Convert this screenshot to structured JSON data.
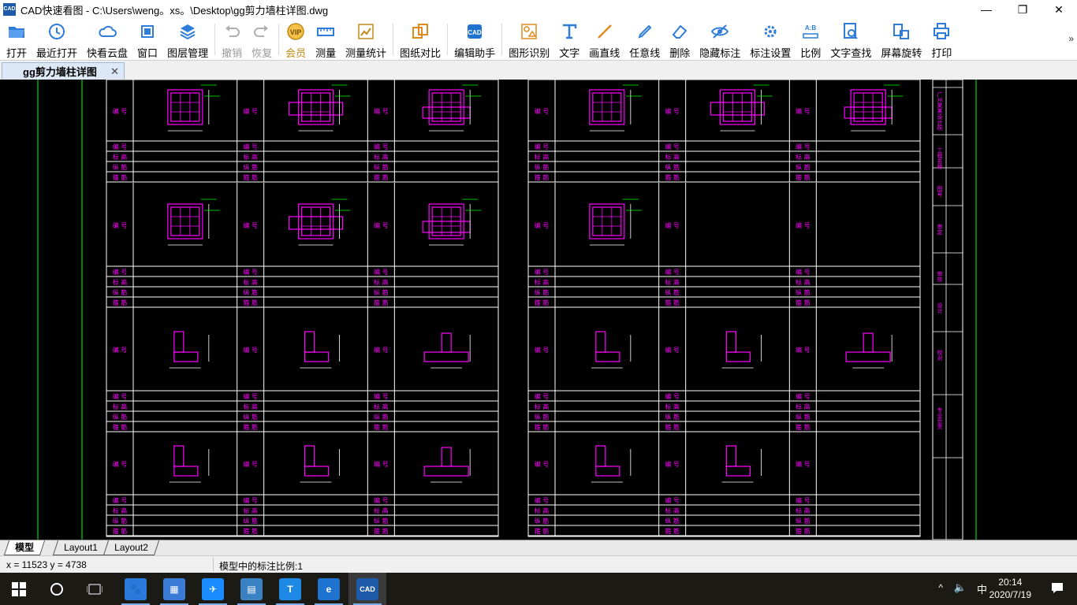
{
  "window": {
    "title": "CAD快速看图 - C:\\Users\\weng。xs。\\Desktop\\gg剪力墙柱详图.dwg",
    "logo_text": "CAD",
    "minimize": "—",
    "restore": "❐",
    "close": "✕"
  },
  "toolbar": {
    "items": [
      {
        "label": "打开",
        "icon": "folder-open-icon",
        "state": "normal"
      },
      {
        "label": "最近打开",
        "icon": "recent-clock-icon",
        "state": "normal"
      },
      {
        "label": "快看云盘",
        "icon": "cloud-icon",
        "state": "normal"
      },
      {
        "label": "窗口",
        "icon": "window-frame-icon",
        "state": "normal"
      },
      {
        "label": "图层管理",
        "icon": "layers-icon",
        "state": "normal"
      },
      {
        "label": "撤销",
        "icon": "undo-icon",
        "state": "disabled"
      },
      {
        "label": "恢复",
        "icon": "redo-icon",
        "state": "disabled"
      },
      {
        "label": "会员",
        "icon": "vip-icon",
        "state": "vip"
      },
      {
        "label": "测量",
        "icon": "ruler-icon",
        "state": "normal"
      },
      {
        "label": "测量统计",
        "icon": "measure-stats-icon",
        "state": "normal"
      },
      {
        "label": "图纸对比",
        "icon": "compare-icon",
        "state": "normal"
      },
      {
        "label": "编辑助手",
        "icon": "edit-assistant-icon",
        "state": "normal"
      },
      {
        "label": "图形识别",
        "icon": "shape-recognize-icon",
        "state": "normal"
      },
      {
        "label": "文字",
        "icon": "text-icon",
        "state": "normal"
      },
      {
        "label": "画直线",
        "icon": "line-icon",
        "state": "normal"
      },
      {
        "label": "任意线",
        "icon": "freehand-pen-icon",
        "state": "normal"
      },
      {
        "label": "删除",
        "icon": "eraser-icon",
        "state": "normal"
      },
      {
        "label": "隐藏标注",
        "icon": "hide-eye-icon",
        "state": "normal"
      },
      {
        "label": "标注设置",
        "icon": "annotation-settings-icon",
        "state": "normal"
      },
      {
        "label": "比例",
        "icon": "scale-icon",
        "state": "normal"
      },
      {
        "label": "文字查找",
        "icon": "text-search-icon",
        "state": "normal"
      },
      {
        "label": "屏幕旋转",
        "icon": "screen-rotate-icon",
        "state": "normal"
      },
      {
        "label": "打印",
        "icon": "printer-icon",
        "state": "normal"
      }
    ],
    "more": "»"
  },
  "doc_tab": {
    "label": "gg剪力墙柱详图",
    "close": "✕"
  },
  "drawing": {
    "header_cells": [
      "编 号",
      "标 高",
      "纵 筋",
      "箍 筋"
    ],
    "left_sheet": {
      "rows": [
        {
          "labels": [
            "GDZ1(GDZ1a)",
            "GDZ2",
            "GDZ3(GDZ3a)"
          ],
          "elev": [
            "-4.400~-0.100",
            "-4.400~-0.100",
            "-4.400~-0.100"
          ],
          "bars": [
            "12Φ20+10Φ16(5Φ16)",
            "12Φ20+10Φ16",
            "12Φ20+5Φ16"
          ],
          "stirrup": [
            "Φ10@100",
            "Φ10@100",
            "Φ10@100"
          ]
        },
        {
          "labels": [
            "GDZ4",
            "GDZ5",
            "GDZ6"
          ],
          "elev": [
            "-4.400~-0.100",
            "-4.400~-0.100",
            "-4.400~-0.100"
          ],
          "bars": [
            "12Φ20+5Φ16",
            "8Φ20+10Φ16",
            "8Φ20+12Φ16"
          ],
          "stirrup": [
            "Φ10@100",
            "Φ10@100",
            "Φ10@100"
          ]
        },
        {
          "labels": [
            "GJZ1",
            "GJZ2",
            "GYZ1"
          ],
          "elev": [
            "-4.400~-0.100",
            "-4.400~-0.100",
            "-4.400~-0.100"
          ],
          "bars": [
            "12Φ16",
            "12Φ16",
            "13Φ16"
          ],
          "stirrup": [
            "Φ10@100",
            "Φ10@100",
            "Φ10@100"
          ]
        },
        {
          "labels": [
            "GYZ2",
            "GYZ3",
            "GAZ1"
          ],
          "elev": [
            "-4.400~-0.100",
            "-4.400~-0.100",
            "-4.400~-0.100"
          ],
          "bars": [
            "18Φ16",
            "16Φ16",
            "8Φ16"
          ],
          "stirrup": [
            "Φ10@100",
            "Φ10@100",
            "Φ10@100"
          ]
        }
      ]
    },
    "right_sheet": {
      "rows": [
        {
          "labels": [
            "GDZ1",
            "GDZ2",
            "GDZ3"
          ],
          "elev": [
            "-0.100~7.700   7.700~15.500",
            "-0.100~7.700   7.700~15.500",
            "-0.100~7.700   7.700~15.500"
          ],
          "bars": [
            "12Φ20+5Φ16   12Φ20+5Φ16",
            "12Φ20+8Φ16   12Φ20+8Φ16",
            "12Φ20+5Φ16   12Φ20+5Φ16"
          ],
          "stirrup": [
            "Φ10@100   Φ8@150",
            "Φ10@100   Φ8@150",
            "Φ10@100   Φ8@150"
          ]
        },
        {
          "labels": [
            "GDZ4",
            "",
            ""
          ],
          "elev": [
            "-0.100~7.700   7.700~19.500",
            "",
            ""
          ],
          "bars": [
            "12Φ20+5Φ16   12Φ20+5Φ16",
            "",
            ""
          ],
          "stirrup": [
            "Φ10@100   Φ8@150",
            "",
            ""
          ]
        },
        {
          "labels": [
            "YJZ1   GJZ1",
            "YJZ2   GJZ2",
            "YYZ1   GYZ1"
          ],
          "elev": [
            "-0.100~7.700   7.700~17.400",
            "-0.100~7.700   7.700~17.400",
            "-0.100~7.700   7.700~17.400"
          ],
          "bars": [
            "12Φ16   12Φ14",
            "12Φ16   12Φ14",
            "18Φ16   18Φ14"
          ],
          "stirrup": [
            "Φ10@100   Φ8@150",
            "Φ10@100   Φ8@150",
            "Φ10@100   Φ8@150"
          ]
        },
        {
          "labels": [
            "YYZ2   GYZ2",
            "YYZ3   GYZ3",
            ""
          ],
          "elev": [
            "-0.100~7.700   7.700~17.400",
            "-0.100~7.700   7.700~17.400",
            ""
          ],
          "bars": [
            "18Φ16   18Φ14",
            "16Φ16   16Φ14",
            ""
          ],
          "stirrup": [
            "Φ10@100   Φ8@150",
            "Φ10@100   Φ8@150",
            ""
          ]
        }
      ]
    },
    "title_block": [
      "广州某某设计院",
      "工程名称",
      "图号",
      "审定",
      "审核",
      "设计",
      "校对",
      "专业负责"
    ]
  },
  "layout_tabs": [
    "模型",
    "Layout1",
    "Layout2"
  ],
  "status": {
    "coords": "x = 11523  y = 4738",
    "scale": "模型中的标注比例:1"
  },
  "taskbar": {
    "apps": [
      {
        "name": "baidu-netdisk-app",
        "glyph": "🐾",
        "color": "#2b7ad9"
      },
      {
        "name": "computer-manager-app",
        "glyph": "▦",
        "color": "#3a7bd5"
      },
      {
        "name": "dingtalk-app",
        "glyph": "✈",
        "color": "#1a8cff"
      },
      {
        "name": "office-assistant-app",
        "glyph": "▤",
        "color": "#3b82c4"
      },
      {
        "name": "text-editor-app",
        "glyph": "T",
        "color": "#1e88e5"
      },
      {
        "name": "edge-browser-app",
        "glyph": "e",
        "color": "#1e73d0"
      },
      {
        "name": "cad-viewer-app",
        "glyph": "CAD",
        "color": "#1e5aa8"
      }
    ],
    "tray_chevron": "^",
    "volume": "🔈",
    "ime": "中",
    "time": "20:14",
    "date": "2020/7/19",
    "notifications": "▭"
  }
}
